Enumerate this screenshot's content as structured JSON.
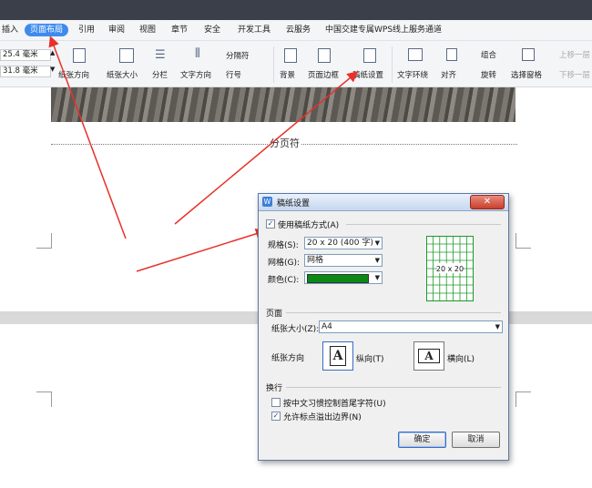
{
  "menu": {
    "tabs": [
      {
        "label": "插入",
        "active": false
      },
      {
        "label": "页面布局",
        "active": true
      },
      {
        "label": "引用",
        "active": false
      },
      {
        "label": "审阅",
        "active": false
      },
      {
        "label": "视图",
        "active": false
      },
      {
        "label": "章节",
        "active": false
      },
      {
        "label": "安全",
        "active": false
      },
      {
        "label": "开发工具",
        "active": false
      },
      {
        "label": "云服务",
        "active": false
      },
      {
        "label": "中国交建专属WPS线上服务通道",
        "active": false
      }
    ]
  },
  "ribbon": {
    "margin_top_value": "25.4 毫米",
    "margin_bottom_value": "31.8 毫米",
    "paper_orientation": "纸张方向",
    "paper_size": "纸张大小",
    "columns": "分栏",
    "text_direction": "文字方向",
    "separator": "分隔符",
    "line_number": "行号",
    "background": "背景",
    "page_border": "页面边框",
    "manuscript_setup": "稿纸设置",
    "text_wrap": "文字环绕",
    "align": "对齐",
    "group": "组合",
    "rotate": "旋转",
    "selection_pane": "选择窗格",
    "move_up": "上移一层",
    "move_down": "下移一层"
  },
  "document": {
    "page_break_label": "分页符"
  },
  "dialog": {
    "title": "稿纸设置",
    "use_manuscript_label": "使用稿纸方式(A)",
    "use_manuscript_checked": true,
    "spec_label": "规格(S):",
    "spec_value": "20 x 20 (400 字)",
    "grid_label": "网格(G):",
    "grid_value": "网格",
    "color_label": "颜色(C):",
    "color_value": "#0a8a12",
    "preview_text": "20 x 20",
    "page_section": "页面",
    "paper_size_label": "纸张大小(Z):",
    "paper_size_value": "A4",
    "orientation_label": "纸张方向",
    "portrait_label": "纵向(T)",
    "landscape_label": "横向(L)",
    "orientation_glyph": "A",
    "wrap_section": "换行",
    "opt_chinese_punct": "按中文习惯控制首尾字符(U)",
    "opt_chinese_punct_checked": false,
    "opt_overflow": "允许标点溢出边界(N)",
    "opt_overflow_checked": true,
    "ok_label": "确定",
    "cancel_label": "取消"
  },
  "colors": {
    "accent": "#3e8bf0",
    "annotation_arrow": "#e8312a",
    "grid_green": "#1a9a2a"
  }
}
